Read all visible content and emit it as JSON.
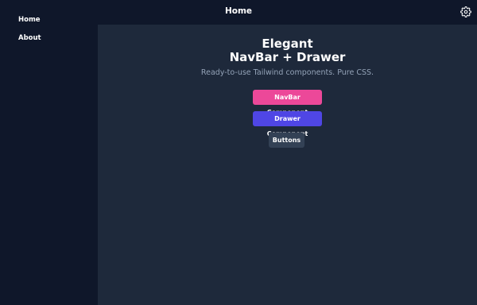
{
  "topbar": {
    "title": "Home",
    "settings_icon": "gear-icon"
  },
  "sidebar": {
    "items": [
      {
        "label": "Home"
      },
      {
        "label": "About"
      }
    ]
  },
  "main": {
    "title_line1": "Elegant",
    "title_line2": "NavBar + Drawer",
    "subtitle": "Ready-to-use Tailwind components. Pure CSS.",
    "buttons": [
      {
        "label": "NavBar Component",
        "color": "#ec4899"
      },
      {
        "label": "Drawer Component",
        "color": "#4f46e5"
      },
      {
        "label": "Buttons",
        "color": "#334155"
      }
    ]
  }
}
